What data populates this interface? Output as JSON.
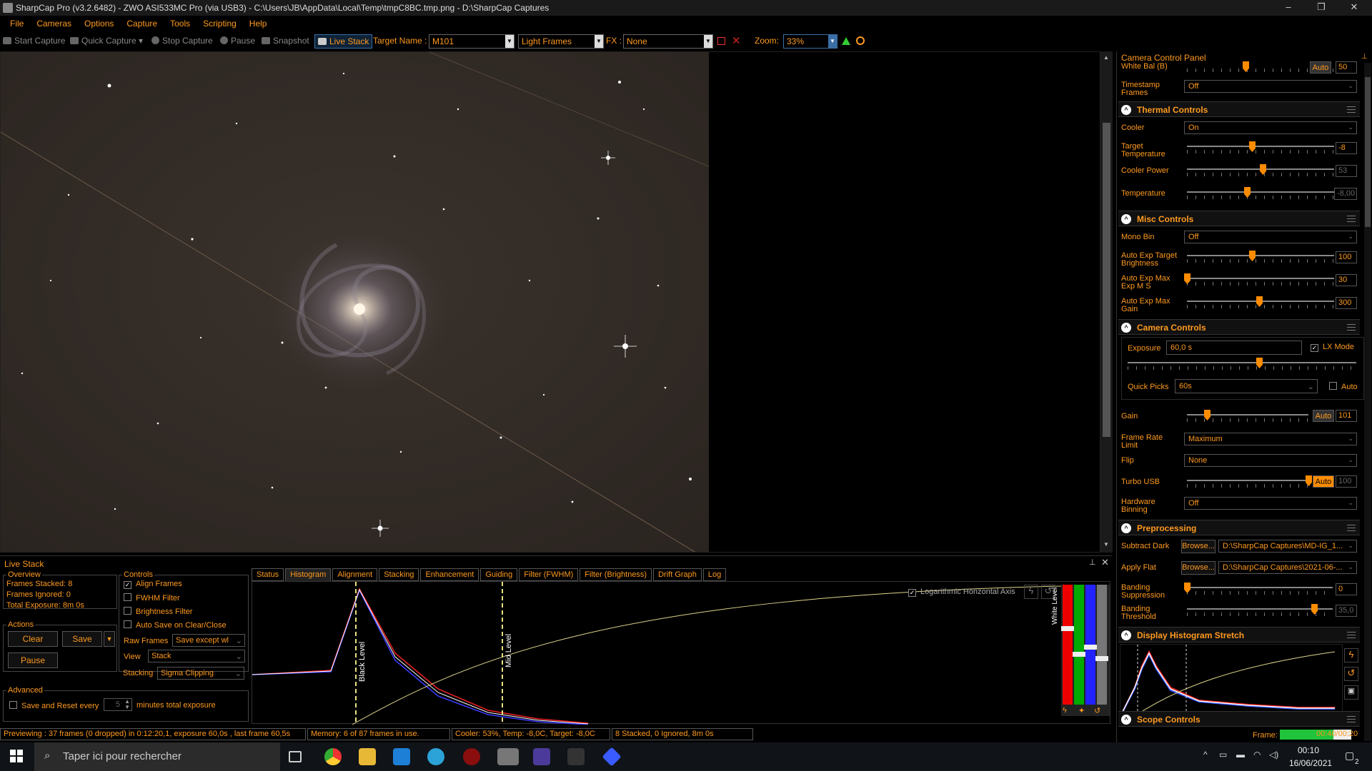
{
  "window": {
    "title": "SharpCap Pro (v3.2.6482) - ZWO ASI533MC Pro (via USB3) - C:\\Users\\JB\\AppData\\Local\\Temp\\tmpC8BC.tmp.png - D:\\SharpCap Captures",
    "minimize": "–",
    "maximize": "❐",
    "close": "✕"
  },
  "menu": [
    "File",
    "Cameras",
    "Options",
    "Capture",
    "Tools",
    "Scripting",
    "Help"
  ],
  "toolbar": {
    "start_capture": "Start Capture",
    "quick_capture": "Quick Capture",
    "stop_capture": "Stop Capture",
    "pause": "Pause",
    "snapshot": "Snapshot",
    "live_stack": "Live Stack",
    "target_name_label": "Target Name :",
    "target_name_value": "M101",
    "frame_type": "Light Frames",
    "fx_label": "FX :",
    "fx_value": "None",
    "zoom_label": "Zoom:",
    "zoom_value": "33%"
  },
  "ccp": {
    "title": "Camera Control Panel",
    "white_bal_label": "White Bal (B)",
    "white_bal_auto": "Auto",
    "white_bal_value": "50",
    "timestamp_label": "Timestamp Frames",
    "timestamp_value": "Off",
    "thermal": {
      "title": "Thermal Controls",
      "cooler_label": "Cooler",
      "cooler_value": "On",
      "target_temp_label": "Target Temperature",
      "target_temp_value": "-8",
      "cooler_power_label": "Cooler Power",
      "cooler_power_value": "53",
      "temperature_label": "Temperature",
      "temperature_value": "-8,00"
    },
    "misc": {
      "title": "Misc Controls",
      "mono_bin_label": "Mono Bin",
      "mono_bin_value": "Off",
      "ae_target_label": "Auto Exp Target Brightness",
      "ae_target_value": "100",
      "ae_max_exp_label": "Auto Exp Max Exp M S",
      "ae_max_exp_value": "30",
      "ae_max_gain_label": "Auto Exp Max Gain",
      "ae_max_gain_value": "300"
    },
    "camera": {
      "title": "Camera Controls",
      "exposure_label": "Exposure",
      "exposure_value": "60,0 s",
      "lx_mode_label": "LX Mode",
      "quick_picks_label": "Quick Picks",
      "quick_picks_value": "60s",
      "auto_label": "Auto",
      "gain_label": "Gain",
      "gain_auto": "Auto",
      "gain_value": "101",
      "frame_rate_label": "Frame Rate Limit",
      "frame_rate_value": "Maximum",
      "flip_label": "Flip",
      "flip_value": "None",
      "turbo_label": "Turbo USB",
      "turbo_auto": "Auto",
      "turbo_value": "100",
      "binning_label": "Hardware Binning",
      "binning_value": "Off"
    },
    "preprocessing": {
      "title": "Preprocessing",
      "dark_label": "Subtract Dark",
      "dark_browse": "Browse...",
      "dark_value": "D:\\SharpCap Captures\\MD-IG_1...",
      "flat_label": "Apply Flat",
      "flat_browse": "Browse...",
      "flat_value": "D:\\SharpCap Captures\\2021-06-...",
      "banding_sup_label": "Banding Suppression",
      "banding_sup_value": "0",
      "banding_thr_label": "Banding Threshold",
      "banding_thr_value": "35,0"
    },
    "histogram_stretch_title": "Display Histogram Stretch",
    "scope_title": "Scope Controls",
    "frame_label": "Frame:",
    "frame_time": "00:40/00:20",
    "frame_progress": 0.75
  },
  "livestack": {
    "title": "Live Stack",
    "overview_title": "Overview",
    "frames_stacked": "Frames Stacked:  8",
    "frames_ignored": "Frames Ignored:  0",
    "total_exposure": "Total Exposure:  8m 0s",
    "actions_title": "Actions",
    "clear": "Clear",
    "save": "Save",
    "pause": "Pause",
    "controls_title": "Controls",
    "align_frames": "Align Frames",
    "fwhm_filter": "FWHM Filter",
    "brightness_filter": "Brightness Filter",
    "auto_save": "Auto Save on Clear/Close",
    "raw_frames_label": "Raw Frames",
    "raw_frames_value": "Save except wl",
    "view_label": "View",
    "view_value": "Stack",
    "stacking_label": "Stacking",
    "stacking_value": "Sigma Clipping",
    "advanced_title": "Advanced",
    "save_reset_label": "Save and Reset every",
    "save_reset_value": "5",
    "save_reset_suffix": "minutes total exposure",
    "tabs": [
      "Status",
      "Histogram",
      "Alignment",
      "Stacking",
      "Enhancement",
      "Guiding",
      "Filter (FWHM)",
      "Filter (Brightness)",
      "Drift Graph",
      "Log"
    ],
    "log_axis_label": "Logarithmic Horizontal Axis",
    "black_level_label": "Black Level",
    "mid_level_label": "Mid Level",
    "white_level_label": "White Level"
  },
  "status": {
    "previewing": "Previewing : 37 frames (0 dropped) in 0:12:20,1, exposure 60,0s , last frame 60,5s",
    "memory": "Memory: 6 of 87 frames in use.",
    "cooler": "Cooler: 53%, Temp: -8,0C, Target: -8,0C",
    "stacked": "8 Stacked, 0 Ignored, 8m 0s"
  },
  "taskbar": {
    "search_placeholder": "Taper ici pour rechercher",
    "time": "00:10",
    "date": "16/06/2021",
    "notifications": "2"
  }
}
